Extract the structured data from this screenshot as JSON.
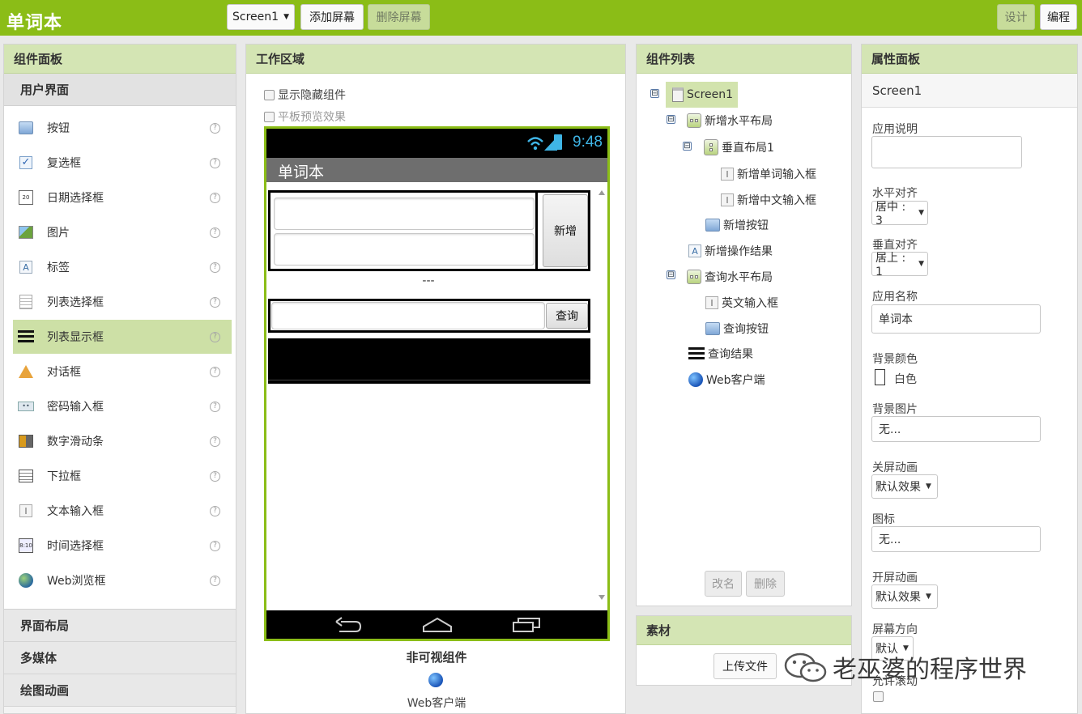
{
  "app": {
    "title": "单词本"
  },
  "toolbar": {
    "screen_select": "Screen1",
    "add_screen": "添加屏幕",
    "remove_screen": "删除屏幕",
    "designer": "设计",
    "blocks": "编程"
  },
  "palette": {
    "title": "组件面板",
    "category_open": "用户界面",
    "items": [
      {
        "label": "按钮",
        "icon": "button-icon"
      },
      {
        "label": "复选框",
        "icon": "checkbox-icon"
      },
      {
        "label": "日期选择框",
        "icon": "date-picker-icon"
      },
      {
        "label": "图片",
        "icon": "image-icon"
      },
      {
        "label": "标签",
        "icon": "label-icon"
      },
      {
        "label": "列表选择框",
        "icon": "list-picker-icon"
      },
      {
        "label": "列表显示框",
        "icon": "list-view-icon"
      },
      {
        "label": "对话框",
        "icon": "notifier-icon"
      },
      {
        "label": "密码输入框",
        "icon": "password-icon"
      },
      {
        "label": "数字滑动条",
        "icon": "slider-icon"
      },
      {
        "label": "下拉框",
        "icon": "spinner-icon"
      },
      {
        "label": "文本输入框",
        "icon": "textbox-icon"
      },
      {
        "label": "时间选择框",
        "icon": "time-picker-icon"
      },
      {
        "label": "Web浏览框",
        "icon": "web-viewer-icon"
      }
    ],
    "help_glyph": "?",
    "selected_item": "列表显示框",
    "categories": [
      "界面布局",
      "多媒体",
      "绘图动画"
    ]
  },
  "workspace": {
    "title": "工作区域",
    "show_hidden": "显示隐藏组件",
    "tablet_preview": "平板预览效果",
    "status_time": "9:48",
    "screen_title": "单词本",
    "add_button": "新增",
    "result_text": "---",
    "query_button": "查询",
    "nonvisible_title": "非可视组件",
    "nonvisible_item": "Web客户端"
  },
  "tree": {
    "title": "组件列表",
    "nodes": {
      "screen": "Screen1",
      "hbox_add": "新增水平布局",
      "vbox": "垂直布局1",
      "tb_word": "新增单词输入框",
      "tb_cn": "新增中文输入框",
      "btn_add": "新增按钮",
      "lbl_result": "新增操作结果",
      "hbox_query": "查询水平布局",
      "tb_en": "英文输入框",
      "btn_query": "查询按钮",
      "lv_result": "查询结果",
      "web": "Web客户端"
    },
    "collapse_glyph": "⊟",
    "rename": "改名",
    "delete": "删除"
  },
  "assets": {
    "title": "素材",
    "upload": "上传文件"
  },
  "properties": {
    "title": "属性面板",
    "component": "Screen1",
    "about_label": "应用说明",
    "align_h_label": "水平对齐",
    "align_h_value": "居中 : 3",
    "align_v_label": "垂直对齐",
    "align_v_value": "居上 : 1",
    "app_name_label": "应用名称",
    "app_name_value": "单词本",
    "bg_color_label": "背景颜色",
    "bg_color_value": "白色",
    "bg_image_label": "背景图片",
    "bg_image_value": "无...",
    "close_anim_label": "关屏动画",
    "close_anim_value": "默认效果",
    "icon_label": "图标",
    "icon_value": "无...",
    "open_anim_label": "开屏动画",
    "open_anim_value": "默认效果",
    "orientation_label": "屏幕方向",
    "orientation_value": "默认",
    "scroll_label": "允许滚动"
  },
  "watermark": {
    "text": "老巫婆的程序世界"
  },
  "colors": {
    "accent": "#8bbd17",
    "panel_header": "#d4e5b4",
    "selection": "#cde0a6"
  }
}
